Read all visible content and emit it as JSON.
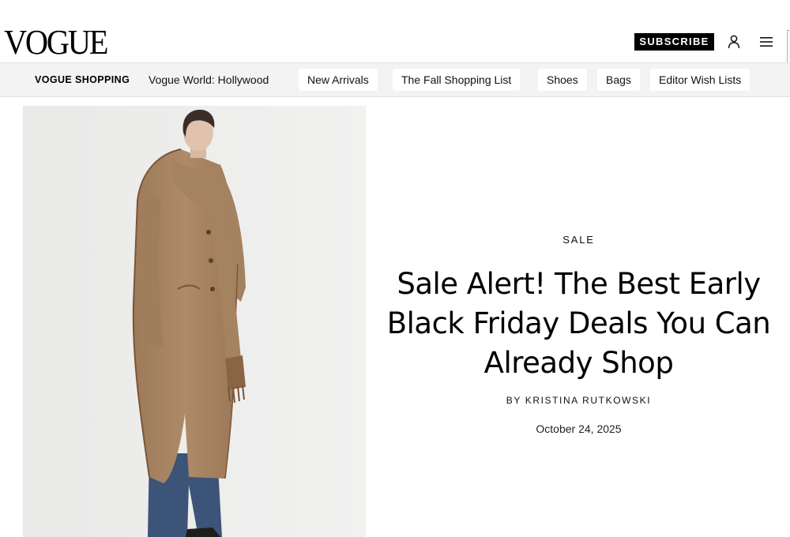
{
  "header": {
    "logo": "VOGUE",
    "subscribe_label": "SUBSCRIBE",
    "account_icon": "account-icon",
    "menu_icon": "hamburger-menu-icon"
  },
  "nav": {
    "brand": "VOGUE SHOPPING",
    "items": [
      {
        "label": "Vogue World: Hollywood"
      },
      {
        "label": "New Arrivals"
      },
      {
        "label": "The Fall Shopping List"
      },
      {
        "label": "Shoes"
      },
      {
        "label": "Bags"
      },
      {
        "label": "Editor Wish Lists"
      }
    ]
  },
  "article": {
    "rubric": "SALE",
    "headline": "Sale Alert! The Best Early Black Friday Deals You Can Already Shop",
    "byline_prefix": "BY",
    "author": "KRISTINA RUTKOWSKI",
    "date": "October 24, 2025"
  },
  "colors": {
    "background": "#ffffff",
    "subscribe_bg": "#000000",
    "nav_bg": "#f3f3f3",
    "coat": "#a98564",
    "jeans": "#3c5478"
  }
}
